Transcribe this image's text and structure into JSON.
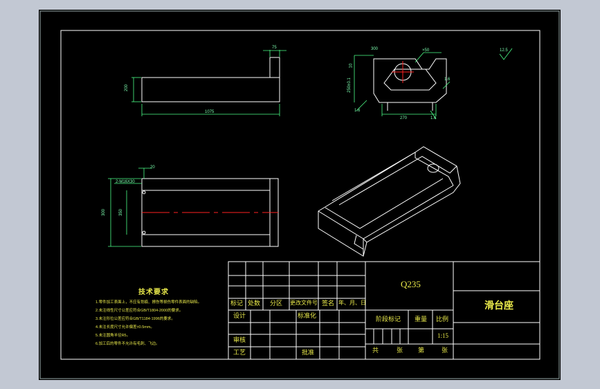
{
  "colors": {
    "background_outer": "#c2c8d3",
    "paper": "#000000",
    "line": "#ffffff",
    "dimension": "#4dff88",
    "text_yellow": "#e8e84a",
    "center_line": "#ff2020"
  },
  "dimensions": {
    "top_view_width": "75",
    "top_view_height": "200",
    "top_view_length": "1075",
    "side_top_width": "300",
    "side_height": "10",
    "side_left_height": "250±0.1",
    "side_bottom_width": "270",
    "side_hole": "×50",
    "side_chamfer_left": "1.6",
    "side_chamfer_right": "1.6",
    "side_bevel_right": "1.6",
    "front_hole_note": "2-M16X30",
    "front_offset": "20",
    "front_height": "300",
    "front_inner": "350",
    "roughness": "12.5"
  },
  "tech": {
    "title": "技术要求",
    "items": [
      "1.零件加工表面上，不应有划痕、擦伤等损伤零件表面的缺陷。",
      "2.未注线性尺寸公差应符合GB/T1804-2000的要求。",
      "3.未注形位公差应符合GB/T1184-1996的要求。",
      "4.未注长度尺寸允许偏差±0.5mm。",
      "5.未注圆角半径R5。",
      "6.加工后的零件不允许有毛刺、飞边。"
    ]
  },
  "title_block": {
    "material": "Q235",
    "part_name": "滑台座",
    "mark": "标记",
    "count": "处数",
    "zone": "分区",
    "change_doc": "更改文件号",
    "signature": "签名",
    "date": "年、月、日",
    "design": "设计",
    "standardization": "标准化",
    "stage_mark": "阶段标记",
    "weight": "重量",
    "scale": "比例",
    "scale_value": "1:15",
    "review": "审核",
    "process": "工艺",
    "approve": "批准",
    "total": "共",
    "sheets": "张",
    "sheet_no": "第",
    "sheets2": "张"
  }
}
